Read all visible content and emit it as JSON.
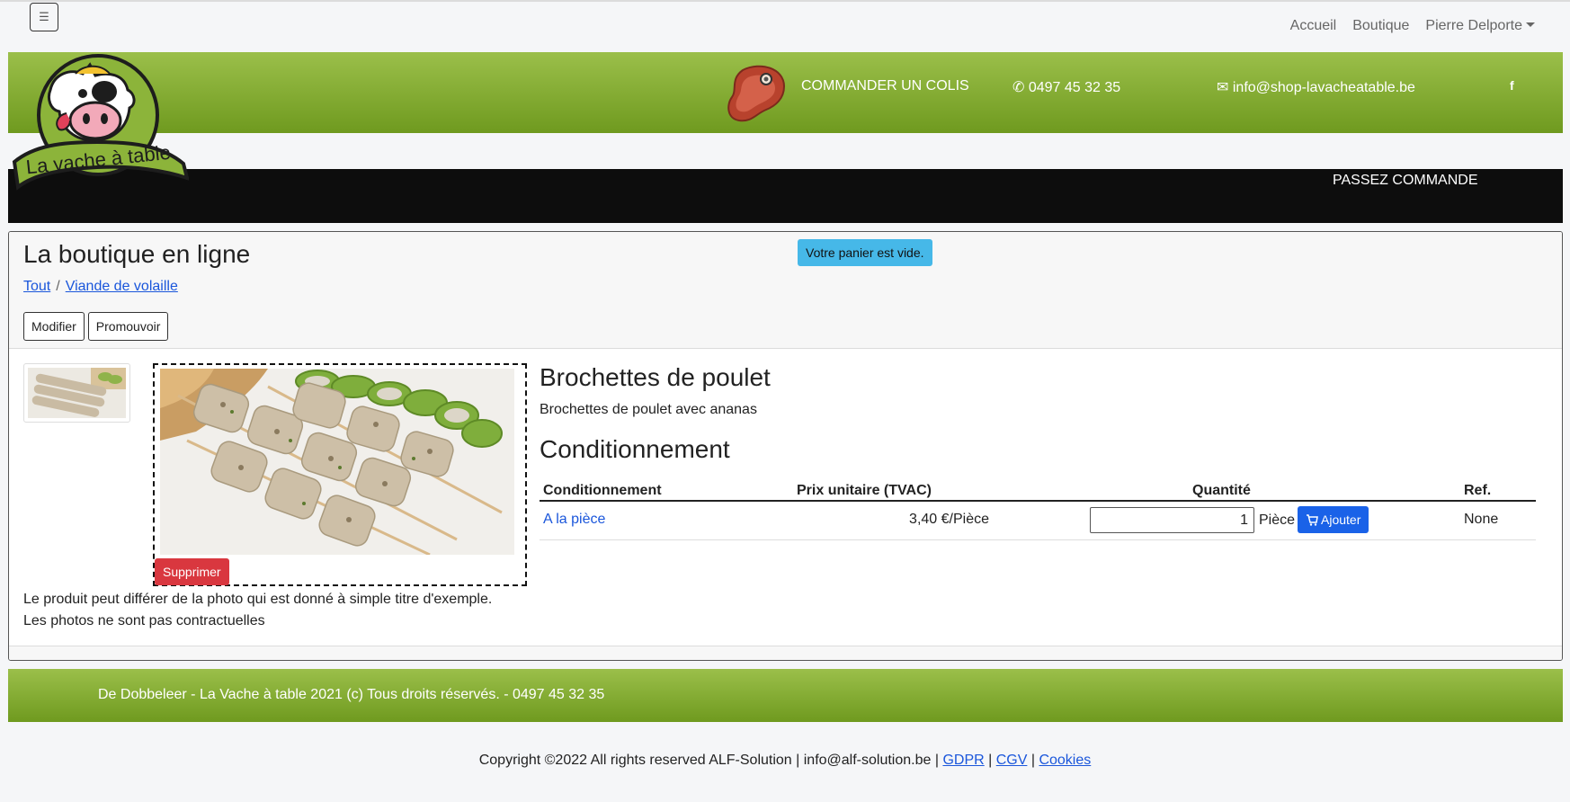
{
  "topbar": {
    "menu_icon": "hamburger-icon",
    "nav": [
      "Accueil",
      "Boutique",
      "Pierre Delporte"
    ]
  },
  "brand": {
    "logo_text": "La vache à table",
    "order_label": "COMMANDER UN COLIS",
    "phone": "0497 45 32 35",
    "email": "info@shop-lavacheatable.be",
    "facebook": "f",
    "passez_label": "PASSEZ COMMANDE",
    "green": "#7fa82f"
  },
  "shop": {
    "title": "La boutique en ligne",
    "cart_status": "Votre panier est vide.",
    "breadcrumb": [
      "Tout",
      "Viande de volaille"
    ],
    "buttons": {
      "modify": "Modifier",
      "promote": "Promouvoir"
    }
  },
  "product": {
    "delete_label": "Supprimer",
    "disclaimer_1": "Le produit peut différer de la photo qui est donné à simple titre d'exemple.",
    "disclaimer_2": "Les photos ne sont pas contractuelles",
    "name": "Brochettes de poulet",
    "description": "Brochettes de poulet avec ananas",
    "packaging_title": "Conditionnement",
    "table": {
      "headers": [
        "Conditionnement",
        "Prix unitaire (TVAC)",
        "Quantité",
        "Ref."
      ],
      "rows": [
        {
          "packaging": "A la pièce",
          "price": "3,40 €/Pièce",
          "quantity": "1",
          "unit": "Pièce",
          "add_label": "Ajouter",
          "ref": "None"
        }
      ]
    }
  },
  "footer": {
    "text": "De Dobbeleer - La Vache à table 2021 (c) Tous droits réservés. - 0497 45 32 35",
    "copyright": "Copyright ©2022 All rights reserved ALF-Solution | info@alf-solution.be |",
    "links": [
      "GDPR",
      "CGV",
      "Cookies"
    ]
  }
}
